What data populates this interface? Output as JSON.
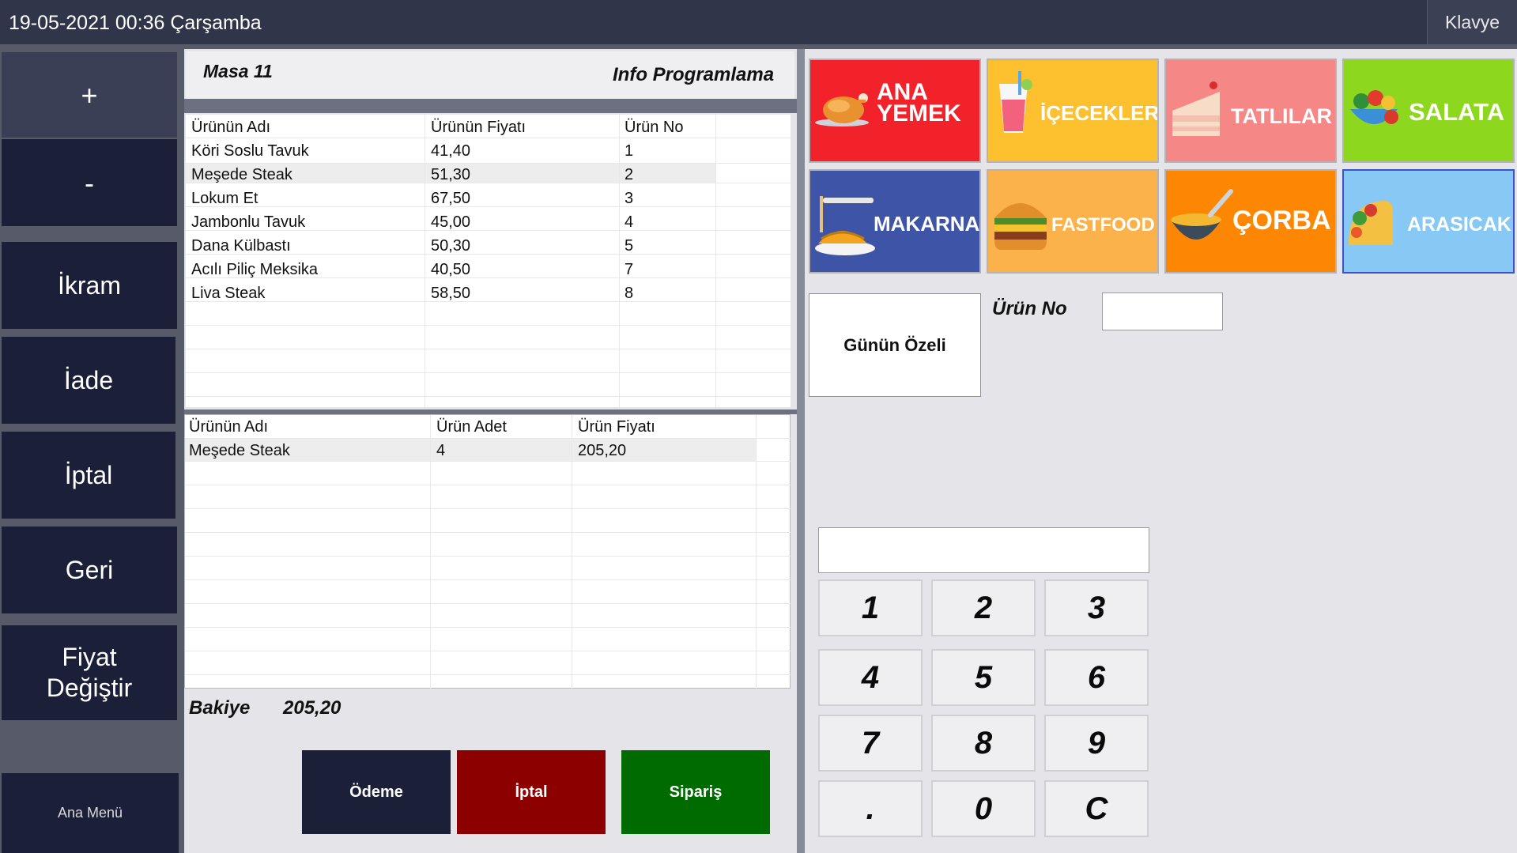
{
  "topbar": {
    "datetime": "19-05-2021 00:36 Çarşamba",
    "keyboard": "Klavye"
  },
  "sidebar": {
    "plus": "+",
    "minus": "-",
    "ikram": "İkram",
    "iade": "İade",
    "iptal": "İptal",
    "geri": "Geri",
    "fiyat_line1": "Fiyat",
    "fiyat_line2": "Değiştir",
    "ana_menu": "Ana Menü"
  },
  "header": {
    "table": "Masa 11",
    "company": "Info Programlama"
  },
  "products": {
    "columns": [
      "Ürünün Adı",
      "Ürünün Fiyatı",
      "Ürün No"
    ],
    "rows": [
      [
        "Köri Soslu Tavuk",
        "41,40",
        "1"
      ],
      [
        "Meşede Steak",
        "51,30",
        "2"
      ],
      [
        "Lokum Et",
        "67,50",
        "3"
      ],
      [
        "Jambonlu Tavuk",
        "45,00",
        "4"
      ],
      [
        "Dana Külbastı",
        "50,30",
        "5"
      ],
      [
        "Acılı Piliç Meksika",
        "40,50",
        "7"
      ],
      [
        "Liva Steak",
        "58,50",
        "8"
      ]
    ]
  },
  "order": {
    "columns": [
      "Ürünün Adı",
      "Ürün Adet",
      "Ürün Fiyatı"
    ],
    "rows": [
      [
        "Meşede Steak",
        "4",
        "205,20"
      ]
    ]
  },
  "balance": {
    "label": "Bakiye",
    "value": "205,20"
  },
  "actions": {
    "payment": "Ödeme",
    "cancel": "İptal",
    "order": "Sipariş"
  },
  "categories": [
    {
      "line1": "ANA",
      "line2": "YEMEK",
      "color": "#f2222a",
      "icon": "roast-chicken-icon"
    },
    {
      "line1": "İÇECEKLER",
      "color": "#fdc02f",
      "icon": "drink-glass-icon"
    },
    {
      "line1": "TATLILAR",
      "color": "#f58787",
      "icon": "cake-slice-icon"
    },
    {
      "line1": "SALATA",
      "color": "#8dd81e",
      "icon": "salad-bowl-icon"
    },
    {
      "line1": "MAKARNA",
      "color": "#3e55a7",
      "icon": "pasta-fork-icon"
    },
    {
      "line1": "FASTFOOD",
      "color": "#fcb24a",
      "icon": "hamburger-icon"
    },
    {
      "line1": "ÇORBA",
      "color": "#fd8602",
      "icon": "soup-bowl-icon"
    },
    {
      "line1": "ARASICAK",
      "color": "#87c8f5",
      "icon": "taco-icon"
    }
  ],
  "special": "Günün Özeli",
  "product_no_label": "Ürün No",
  "keypad": [
    "1",
    "2",
    "3",
    "4",
    "5",
    "6",
    "7",
    "8",
    "9",
    ".",
    "0",
    "C"
  ]
}
